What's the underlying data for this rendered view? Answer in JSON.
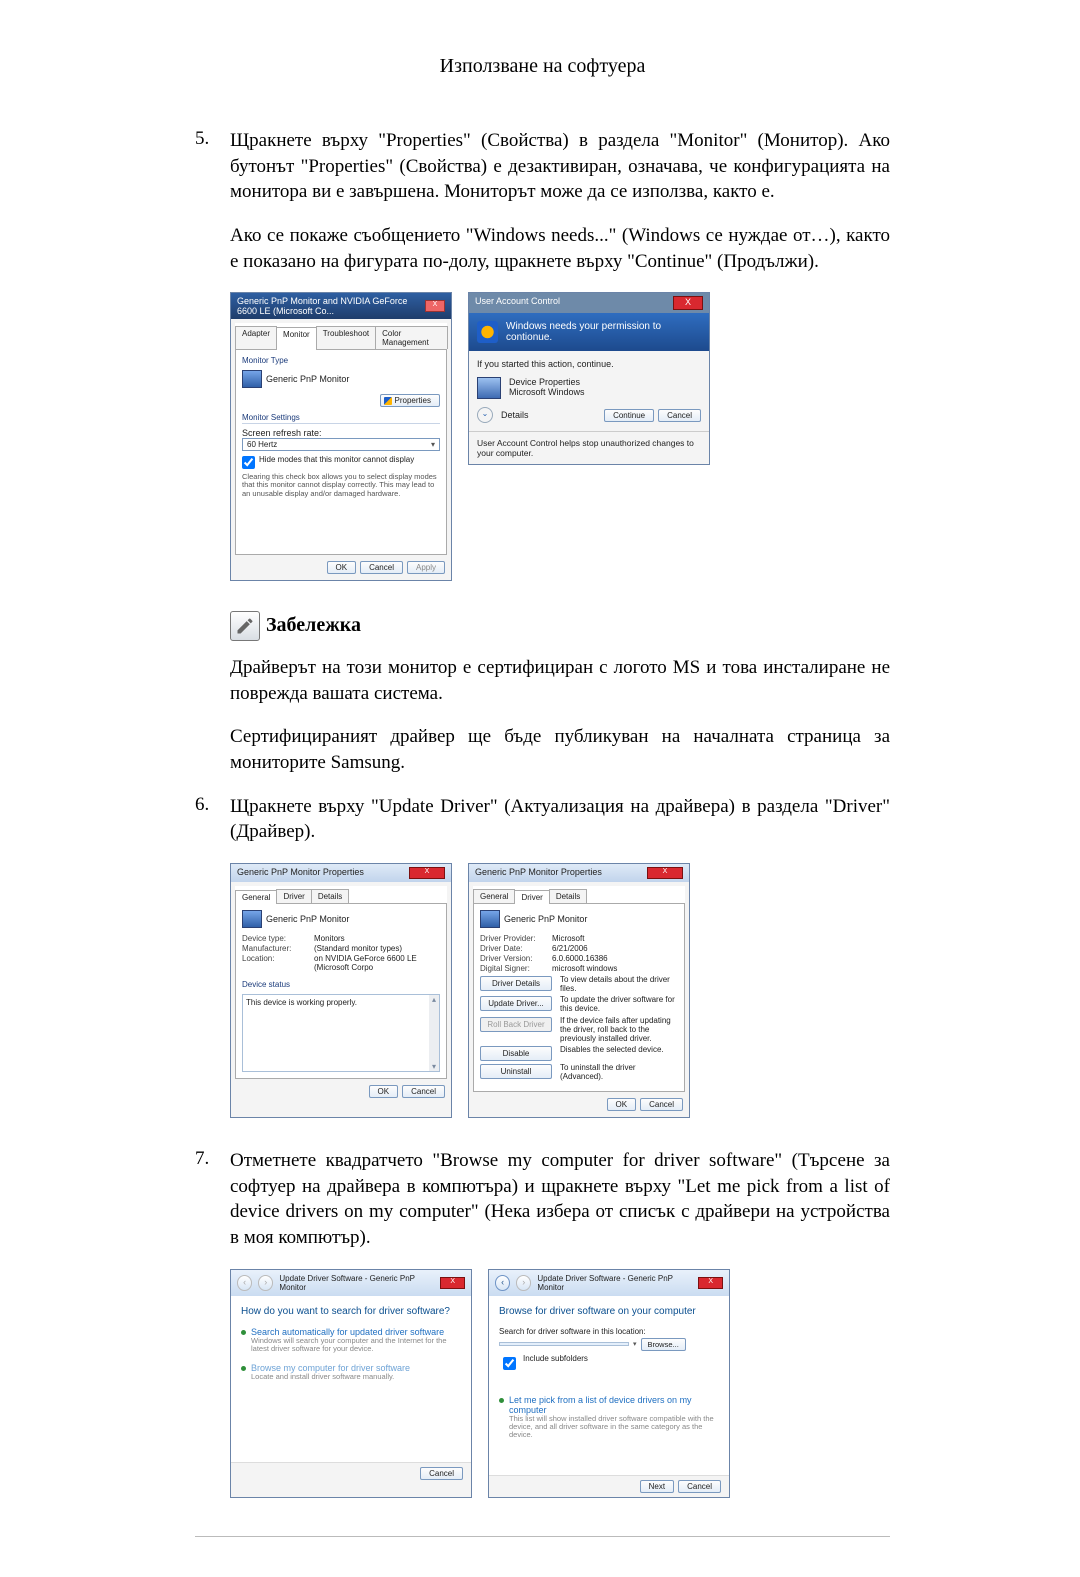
{
  "header": {
    "title": "Използване на софтуера"
  },
  "step5": {
    "num": "5.",
    "text": "Щракнете върху \"Properties\" (Свойства) в раздела \"Monitor\" (Монитор). Ако бутонът \"Properties\" (Свойства) е дезактивиран, означава, че конфигурацията на монитора ви е завършена. Мониторът може да се използва, както е.",
    "text2": "Ако се покаже съобщението \"Windows needs...\" (Windows се нуждае от…), както е показано на фигурата по-долу, щракнете върху \"Continue\" (Продължи)."
  },
  "dlg1": {
    "title": "Generic PnP Monitor and NVIDIA GeForce 6600 LE (Microsoft Co...",
    "sysbtn": "X",
    "tabs": {
      "adapter": "Adapter",
      "monitor": "Monitor",
      "troubleshoot": "Troubleshoot",
      "color": "Color Management"
    },
    "sec_monitor_type": "Monitor Type",
    "monitor_name": "Generic PnP Monitor",
    "btn_properties": "Properties",
    "sec_settings": "Monitor Settings",
    "refresh_label": "Screen refresh rate:",
    "refresh_value": "60 Hertz",
    "arrow": "▾",
    "hide_label": "Hide modes that this monitor cannot display",
    "hide_desc": "Clearing this check box allows you to select display modes that this monitor cannot display correctly. This may lead to an unusable display and/or damaged hardware.",
    "ok": "OK",
    "cancel": "Cancel",
    "apply": "Apply"
  },
  "uac": {
    "title": "User Account Control",
    "close": "X",
    "headline": "Windows needs your permission to contionue.",
    "if_started": "If you started this action, continue.",
    "app_name": "Device Properties",
    "app_pub": "Microsoft Windows",
    "details": "Details",
    "continue": "Continue",
    "cancel": "Cancel",
    "footer": "User Account Control helps stop unauthorized changes to your computer."
  },
  "note": {
    "label": "Забележка",
    "p1": "Драйверът на този монитор е сертифициран с логото MS и това инсталиране не поврежда вашата система.",
    "p2": "Сертифицираният драйвер ще бъде публикуван на началната страница за мониторите Samsung."
  },
  "step6": {
    "num": "6.",
    "text": "Щракнете върху \"Update Driver\" (Актуализация на драйвера) в раздела \"Driver\" (Драйвер)."
  },
  "propA": {
    "title": "Generic PnP Monitor Properties",
    "sysbtn": "X",
    "tabs": {
      "general": "General",
      "driver": "Driver",
      "details": "Details"
    },
    "name": "Generic PnP Monitor",
    "kv": {
      "k1": "Device type:",
      "v1": "Monitors",
      "k2": "Manufacturer:",
      "v2": "(Standard monitor types)",
      "k3": "Location:",
      "v3": "on NVIDIA GeForce 6600 LE (Microsoft Corpo"
    },
    "sec_status": "Device status",
    "status": "This device is working properly.",
    "ok": "OK",
    "cancel": "Cancel"
  },
  "propB": {
    "title": "Generic PnP Monitor Properties",
    "sysbtn": "X",
    "tabs": {
      "general": "General",
      "driver": "Driver",
      "details": "Details"
    },
    "name": "Generic PnP Monitor",
    "kv": {
      "k1": "Driver Provider:",
      "v1": "Microsoft",
      "k2": "Driver Date:",
      "v2": "6/21/2006",
      "k3": "Driver Version:",
      "v3": "6.0.6000.16386",
      "k4": "Digital Signer:",
      "v4": "microsoft windows"
    },
    "b1": "Driver Details",
    "d1": "To view details about the driver files.",
    "b2": "Update Driver...",
    "d2": "To update the driver software for this device.",
    "b3": "Roll Back Driver",
    "d3": "If the device fails after updating the driver, roll back to the previously installed driver.",
    "b4": "Disable",
    "d4": "Disables the selected device.",
    "b5": "Uninstall",
    "d5": "To uninstall the driver (Advanced).",
    "ok": "OK",
    "cancel": "Cancel"
  },
  "step7": {
    "num": "7.",
    "text": "Отметнете квадратчето \"Browse my computer for driver software\" (Търсене за софтуер на драйвера в компютъра) и щракнете върху \"Let me pick from a list of device drivers on my computer\" (Нека избера от списък с драйвери на устройства в моя компютър)."
  },
  "wizA": {
    "crumb": "Update Driver Software - Generic PnP Monitor",
    "close": "X",
    "heading": "How do you want to search for driver software?",
    "opt1_t": "Search automatically for updated driver software",
    "opt1_d": "Windows will search your computer and the Internet for the latest driver software for your device.",
    "opt2_t": "Browse my computer for driver software",
    "opt2_d": "Locate and install driver software manually.",
    "cancel": "Cancel"
  },
  "wizB": {
    "crumb": "Update Driver Software - Generic PnP Monitor",
    "close": "X",
    "heading": "Browse for driver software on your computer",
    "loc_label": "Search for driver software in this location:",
    "path": "",
    "arrow": "▾",
    "browse": "Browse...",
    "include": "Include subfolders",
    "opt_t": "Let me pick from a list of device drivers on my computer",
    "opt_d": "This list will show installed driver software compatible with the device, and all driver software in the same category as the device.",
    "next": "Next",
    "cancel": "Cancel"
  }
}
